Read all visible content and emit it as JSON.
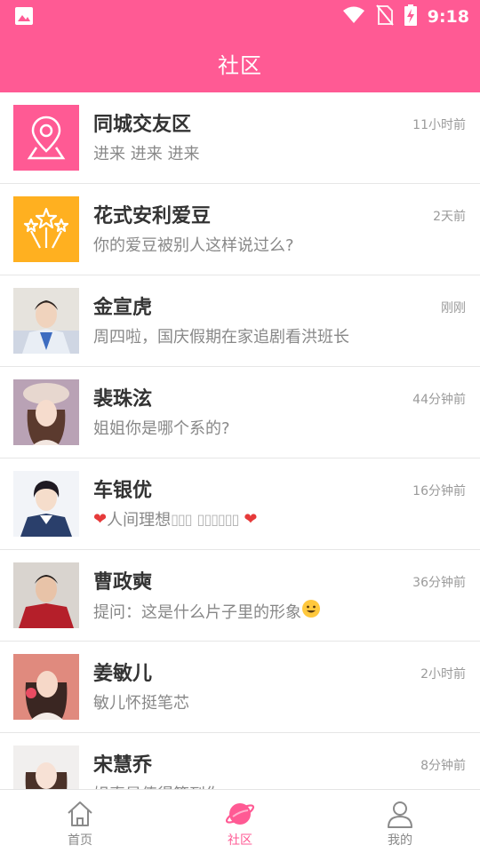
{
  "status_bar": {
    "time": "9:18"
  },
  "header": {
    "title": "社区"
  },
  "colors": {
    "brand": "#ff5a94",
    "accent_orange": "#ffb020",
    "heart": "#e63a3a"
  },
  "items": [
    {
      "title": "同城交友区",
      "subtitle": "进来 进来 进来",
      "time": "11小时前",
      "icon": "map-pin-icon"
    },
    {
      "title": "花式安利爱豆",
      "subtitle": "你的爱豆被别人这样说过么?",
      "time": "2天前",
      "icon": "fireworks-icon"
    },
    {
      "title": "金宣虎",
      "subtitle": "周四啦，国庆假期在家追剧看洪班长",
      "time": "刚刚",
      "icon": "avatar-photo"
    },
    {
      "title": "裴珠泫",
      "subtitle": "姐姐你是哪个系的?",
      "time": "44分钟前",
      "icon": "avatar-photo"
    },
    {
      "title": "车银优",
      "subtitle": "人间理想",
      "subtitle_boxes_1": "▯▯▯",
      "subtitle_boxes_2": "▯▯▯▯▯▯",
      "time": "16分钟前",
      "icon": "avatar-photo"
    },
    {
      "title": "曹政奭",
      "subtitle": "提问：这是什么片子里的形象",
      "time": "36分钟前",
      "icon": "avatar-photo"
    },
    {
      "title": "姜敏儿",
      "subtitle": "敏儿怀挺笔芯",
      "time": "2小时前",
      "icon": "avatar-photo"
    },
    {
      "title": "宋慧乔",
      "subtitle": "姐真是值得等到你",
      "time": "8分钟前",
      "icon": "avatar-photo"
    }
  ],
  "bottom_nav": [
    {
      "label": "首页",
      "icon": "home-icon",
      "active": false
    },
    {
      "label": "社区",
      "icon": "planet-icon",
      "active": true
    },
    {
      "label": "我的",
      "icon": "user-icon",
      "active": false
    }
  ]
}
